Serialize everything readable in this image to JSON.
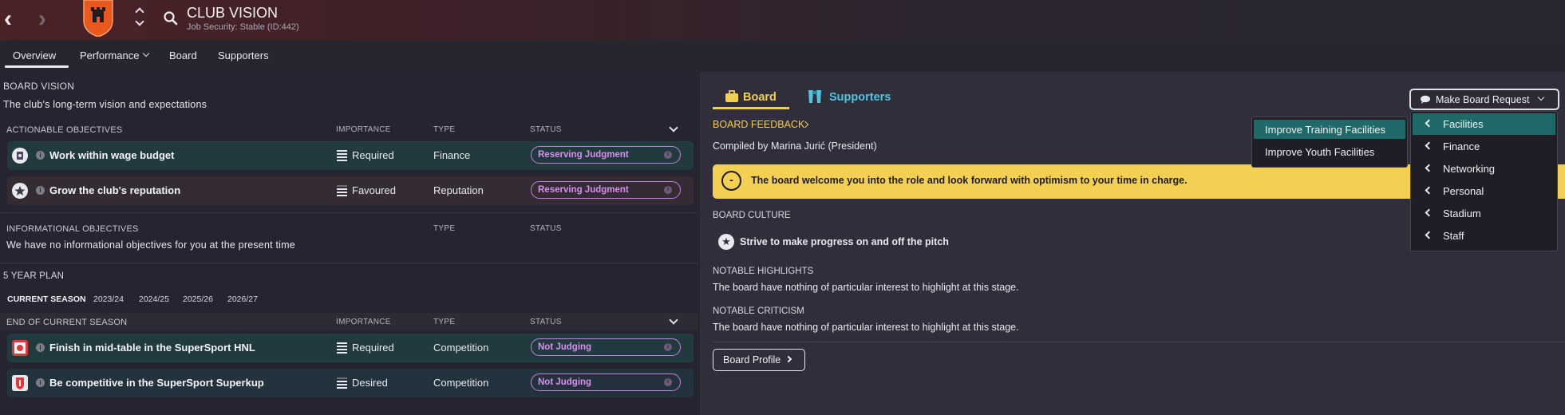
{
  "header": {
    "title": "CLUB VISION",
    "job_security": "Job Security: Stable (ID:442)"
  },
  "tabs": [
    {
      "label": "Overview",
      "active": true
    },
    {
      "label": "Performance",
      "has_dropdown": true
    },
    {
      "label": "Board"
    },
    {
      "label": "Supporters"
    }
  ],
  "board_vision": {
    "heading": "BOARD VISION",
    "subtitle": "The club's long-term vision and expectations"
  },
  "actionable": {
    "heading": "ACTIONABLE OBJECTIVES",
    "col_importance": "IMPORTANCE",
    "col_type": "TYPE",
    "col_status": "STATUS",
    "rows": [
      {
        "name": "Work within wage budget",
        "importance": "Required",
        "type": "Finance",
        "status": "Reserving Judgment",
        "icon": "wage-icon"
      },
      {
        "name": "Grow the club's reputation",
        "importance": "Favoured",
        "type": "Reputation",
        "status": "Reserving Judgment",
        "icon": "star-icon"
      }
    ]
  },
  "informational": {
    "heading": "INFORMATIONAL OBJECTIVES",
    "col_type": "TYPE",
    "col_status": "STATUS",
    "empty_text": "We have no informational objectives for you at the present time"
  },
  "five_year_plan": {
    "heading": "5 YEAR PLAN",
    "seasons": [
      "CURRENT SEASON",
      "2023/24",
      "2024/25",
      "2025/26",
      "2026/27"
    ],
    "end_heading": "END OF CURRENT SEASON",
    "col_importance": "IMPORTANCE",
    "col_type": "TYPE",
    "col_status": "STATUS",
    "rows": [
      {
        "name": "Finish in mid-table in the SuperSport HNL",
        "importance": "Required",
        "type": "Competition",
        "status": "Not Judging",
        "icon": "league-icon"
      },
      {
        "name": "Be competitive in the SuperSport Superkup",
        "importance": "Desired",
        "type": "Competition",
        "status": "Not Judging",
        "icon": "cup-icon"
      }
    ]
  },
  "right": {
    "tab_board": "Board",
    "tab_supporters": "Supporters",
    "feedback_heading": "BOARD FEEDBACK",
    "compiled_by": "Compiled by Marina Jurić (President)",
    "banner_icon": "-",
    "banner_text": "The board welcome you into the role and look forward with optimism to your time in charge.",
    "culture_heading": "BOARD CULTURE",
    "culture_text": "Strive to make progress on and off the pitch",
    "highlights_heading": "NOTABLE HIGHLIGHTS",
    "highlights_text": "The board have nothing of particular interest to highlight at this stage.",
    "criticism_heading": "NOTABLE CRITICISM",
    "criticism_text": "The board have nothing of particular interest to highlight at this stage.",
    "profile_button": "Board Profile"
  },
  "board_request": {
    "button_label": "Make Board Request",
    "menu": [
      "Facilities",
      "Finance",
      "Networking",
      "Personal",
      "Stadium",
      "Staff"
    ],
    "selected": "Facilities",
    "submenu": [
      "Improve Training Facilities",
      "Improve Youth Facilities"
    ],
    "submenu_selected": "Improve Training Facilities"
  },
  "colors": {
    "status_purple": "#c77fdf",
    "banner_yellow": "#f3cf52",
    "board_gold": "#f3cf52",
    "supporters_cyan": "#4fc6e0",
    "menu_selected_teal": "#1f6a68",
    "crest_orange": "#e8591e"
  }
}
